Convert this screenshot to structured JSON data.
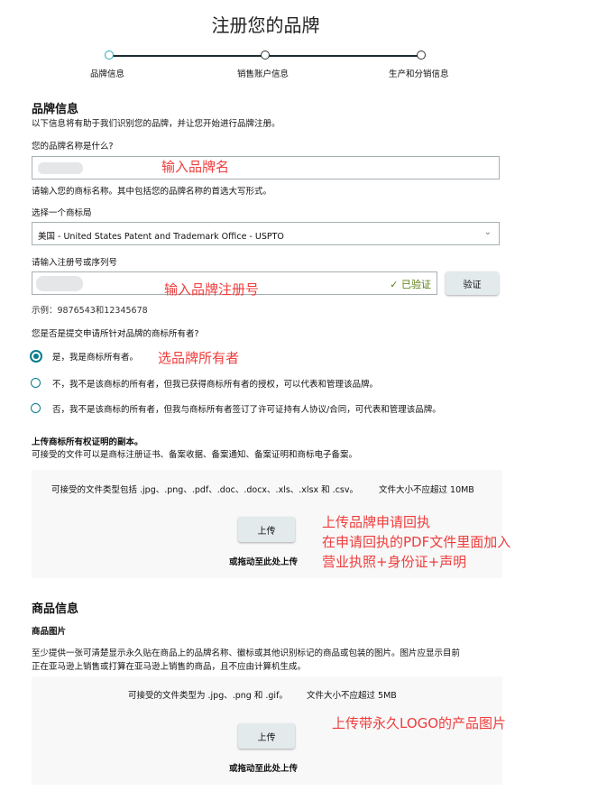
{
  "title": "注册您的品牌",
  "steps": [
    "品牌信息",
    "销售账户信息",
    "生产和分销信息"
  ],
  "brand": {
    "heading": "品牌信息",
    "desc": "以下信息将有助于我们识别您的品牌，并让您开始进行品牌注册。",
    "name_label": "您的品牌名称是什么?",
    "name_hint": "请输入您的商标名称。其中包括您的品牌名称的首选大写形式。",
    "office_label": "选择一个商标局",
    "office_value": "美国 - United States Patent and Trademark Office - USPTO",
    "reg_label": "请输入注册号或序列号",
    "verified": "已验证",
    "verify_button": "验证",
    "example": "示例：9876543和12345678",
    "owner_question": "您是否是提交申请所针对品牌的商标所有者?",
    "options": [
      "是，我是商标所有者。",
      "不，我不是该商标的所有者，但我已获得商标所有者的授权，可以代表和管理该品牌。",
      "否，我不是该商标的所有者，但我与商标所有者签订了许可证持有人协议/合同，可代表和管理该品牌。"
    ],
    "upload_heading": "上传商标所有权证明的副本。",
    "upload_desc": "可接受的文件可以是商标注册证书、备案收据、备案通知、备案证明和商标电子备案。",
    "upload_types": "可接受的文件类型包括 .jpg、.png、.pdf、.doc、.docx、.xls、.xlsx 和 .csv。",
    "upload_size": "文件大小不应超过 10MB",
    "upload_button": "上传",
    "drag_text": "或拖动至此处上传"
  },
  "product": {
    "heading": "商品信息",
    "sub": "商品图片",
    "desc1": "至少提供一张可清楚显示永久贴在商品上的品牌名称、徽标或其他识别标记的商品或包装的图片。图片应显示目前",
    "desc2": "正在亚马逊上销售或打算在亚马逊上销售的商品，且不应由计算机生成。",
    "types": "可接受的文件类型为 .jpg、.png 和 .gif。",
    "size": "文件大小不应超过 5MB",
    "upload_button": "上传",
    "drag_text": "或拖动至此处上传"
  },
  "annotations": {
    "brand_name": "输入品牌名",
    "reg_no": "输入品牌注册号",
    "owner": "选品牌所有者",
    "receipt1": "上传品牌申请回执",
    "receipt2": "在申请回执的PDF文件里面加入",
    "receipt3": "营业执照+身份证+声明",
    "logo": "上传带永久LOGO的产品图片"
  }
}
